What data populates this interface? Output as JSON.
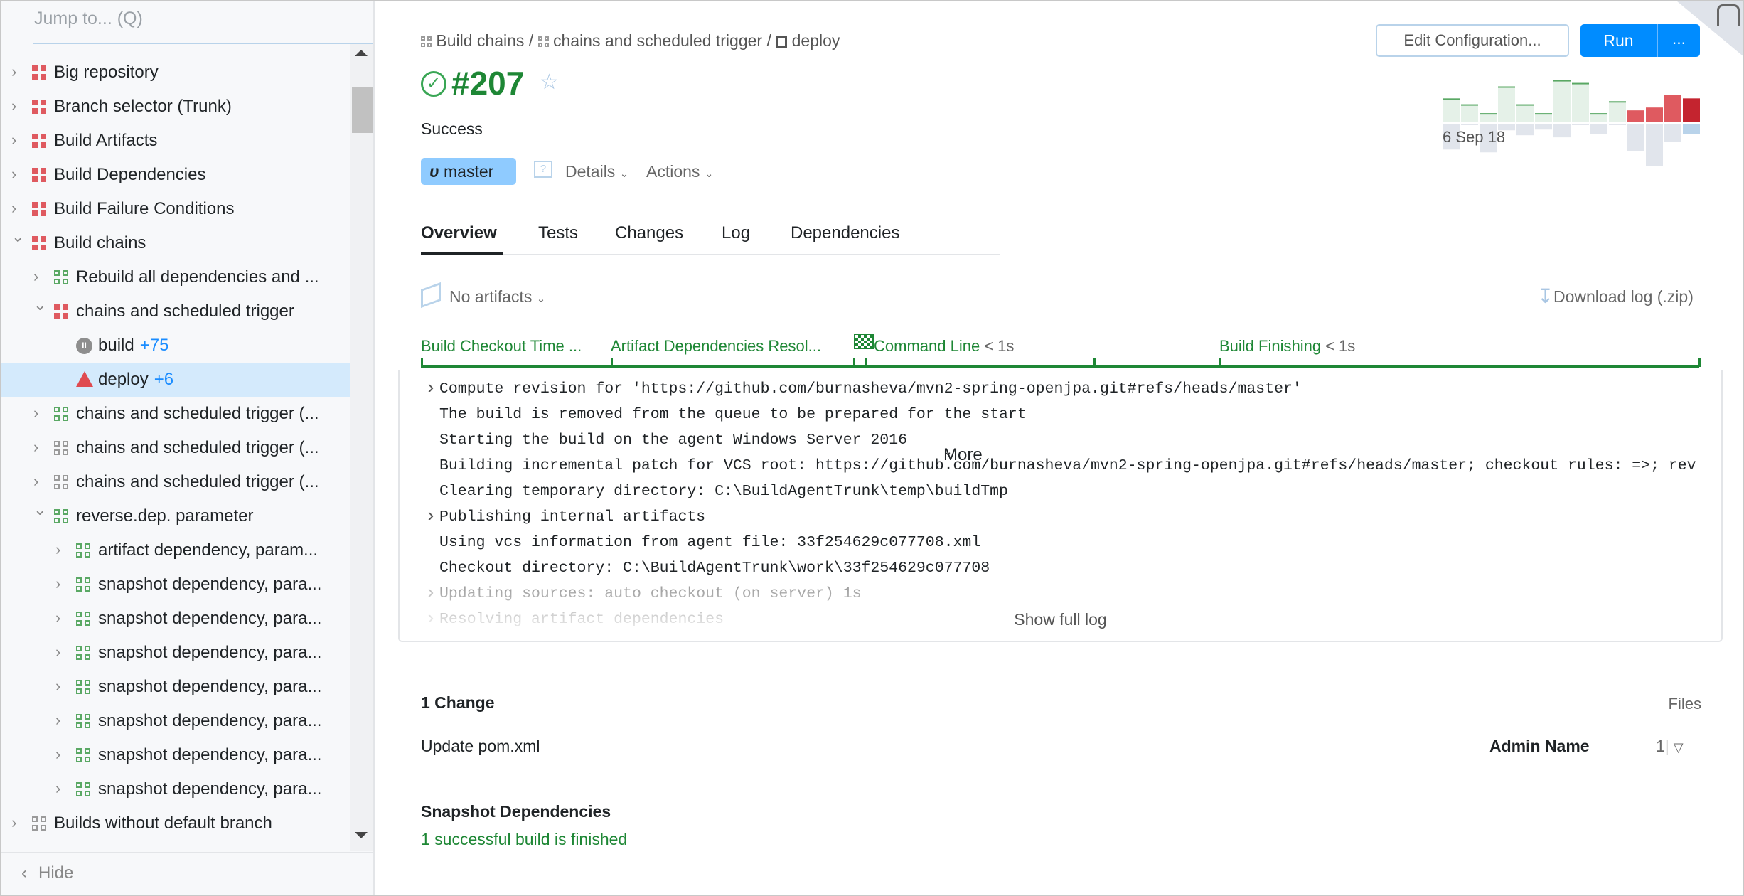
{
  "sidebar": {
    "search_placeholder": "Jump to... (Q)",
    "hide_label": "Hide",
    "items": [
      {
        "level": 0,
        "chevron": "right",
        "icon": "red",
        "label": "Big repository"
      },
      {
        "level": 0,
        "chevron": "right",
        "icon": "red",
        "label": "Branch selector (Trunk)"
      },
      {
        "level": 0,
        "chevron": "right",
        "icon": "red",
        "label": "Build Artifacts"
      },
      {
        "level": 0,
        "chevron": "right",
        "icon": "red",
        "label": "Build Dependencies"
      },
      {
        "level": 0,
        "chevron": "right",
        "icon": "red",
        "label": "Build Failure Conditions"
      },
      {
        "level": 0,
        "chevron": "down",
        "icon": "red",
        "label": "Build chains"
      },
      {
        "level": 1,
        "chevron": "right",
        "icon": "green",
        "label": "Rebuild all dependencies and ..."
      },
      {
        "level": 1,
        "chevron": "down",
        "icon": "red",
        "label": "chains and scheduled trigger"
      },
      {
        "level": 2,
        "chevron": "none",
        "icon": "paused",
        "label": "build",
        "badge": "+75"
      },
      {
        "level": 2,
        "chevron": "none",
        "icon": "warning",
        "label": "deploy",
        "badge": "+6",
        "selected": true
      },
      {
        "level": 1,
        "chevron": "right",
        "icon": "green",
        "label": "chains and scheduled trigger (..."
      },
      {
        "level": 1,
        "chevron": "right",
        "icon": "gray",
        "label": "chains and scheduled trigger (..."
      },
      {
        "level": 1,
        "chevron": "right",
        "icon": "gray",
        "label": "chains and scheduled trigger (..."
      },
      {
        "level": 1,
        "chevron": "down",
        "icon": "green",
        "label": "reverse.dep. parameter"
      },
      {
        "level": 2,
        "chevron": "right",
        "icon": "green",
        "label": "artifact dependency, param..."
      },
      {
        "level": 2,
        "chevron": "right",
        "icon": "green",
        "label": "snapshot dependency, para..."
      },
      {
        "level": 2,
        "chevron": "right",
        "icon": "green",
        "label": "snapshot dependency, para..."
      },
      {
        "level": 2,
        "chevron": "right",
        "icon": "green",
        "label": "snapshot dependency, para..."
      },
      {
        "level": 2,
        "chevron": "right",
        "icon": "green",
        "label": "snapshot dependency, para..."
      },
      {
        "level": 2,
        "chevron": "right",
        "icon": "green",
        "label": "snapshot dependency, para..."
      },
      {
        "level": 2,
        "chevron": "right",
        "icon": "green",
        "label": "snapshot dependency, para..."
      },
      {
        "level": 2,
        "chevron": "right",
        "icon": "green",
        "label": "snapshot dependency, para..."
      },
      {
        "level": 0,
        "chevron": "right",
        "icon": "gray",
        "label": "Builds without default branch"
      }
    ]
  },
  "header": {
    "breadcrumb": [
      "Build chains",
      "chains and scheduled trigger",
      "deploy"
    ],
    "build_number": "#207",
    "status": "Success",
    "branch": "master",
    "details_label": "Details",
    "actions_label": "Actions",
    "edit_config_label": "Edit Configuration...",
    "run_label": "Run",
    "run_more_label": "...",
    "history_date": "6 Sep 18"
  },
  "build_history": {
    "duration": [
      102,
      77,
      39,
      153,
      77,
      39,
      180,
      168,
      39,
      90,
      51,
      63,
      117,
      102
    ],
    "wait": [
      110,
      6,
      122,
      28,
      49,
      25,
      58,
      6,
      43,
      6,
      117,
      180,
      76,
      43
    ],
    "status": [
      "success",
      "success",
      "success",
      "success",
      "success",
      "success",
      "success",
      "success",
      "success",
      "success",
      "failed",
      "failed",
      "failed",
      "failed-current"
    ]
  },
  "colors": {
    "success": "#1e8735",
    "accent": "#008cff",
    "failed": "#df5a60",
    "current_failed": "#c4242f",
    "branch_badge": "#8fcbff"
  },
  "tabs": [
    "Overview",
    "Tests",
    "Changes",
    "Log",
    "Dependencies",
    "More"
  ],
  "artifacts": {
    "label": "No artifacts",
    "download_log": "Download log (.zip)"
  },
  "stages": [
    {
      "label": "Build Checkout Time ...",
      "duration": ""
    },
    {
      "label": "Artifact Dependencies Resol...",
      "duration": ""
    },
    {
      "label": "Command Line",
      "duration": "< 1s"
    },
    {
      "label": "Build Finishing",
      "duration": "< 1s"
    }
  ],
  "log": [
    {
      "expandable": true,
      "text": "Compute revision for 'https://github.com/burnasheva/mvn2-spring-openjpa.git#refs/heads/master'"
    },
    {
      "expandable": false,
      "text": "The build is removed from the queue to be prepared for the start"
    },
    {
      "expandable": false,
      "text": "Starting the build on the agent Windows Server 2016"
    },
    {
      "expandable": false,
      "text": "Building incremental patch for VCS root: https://github.com/burnasheva/mvn2-spring-openjpa.git#refs/heads/master; checkout rules: =>; rev"
    },
    {
      "expandable": false,
      "text": "Clearing temporary directory: C:\\BuildAgentTrunk\\temp\\buildTmp"
    },
    {
      "expandable": true,
      "text": "Publishing internal artifacts"
    },
    {
      "expandable": false,
      "text": "Using vcs information from agent file: 33f254629c077708.xml"
    },
    {
      "expandable": false,
      "text": "Checkout directory: C:\\BuildAgentTrunk\\work\\33f254629c077708"
    },
    {
      "expandable": true,
      "faded": true,
      "text": "Updating sources: auto checkout (on server) 1s"
    },
    {
      "expandable": true,
      "faded": true,
      "text": "Resolving artifact dependencies"
    }
  ],
  "show_full_log": "Show full log",
  "changes": {
    "title": "1 Change",
    "files_label": "Files",
    "items": [
      {
        "message": "Update pom.xml",
        "author": "Admin Name",
        "files": "1"
      }
    ]
  },
  "snapshot": {
    "title": "Snapshot Dependencies",
    "summary": "1 successful build is finished"
  }
}
